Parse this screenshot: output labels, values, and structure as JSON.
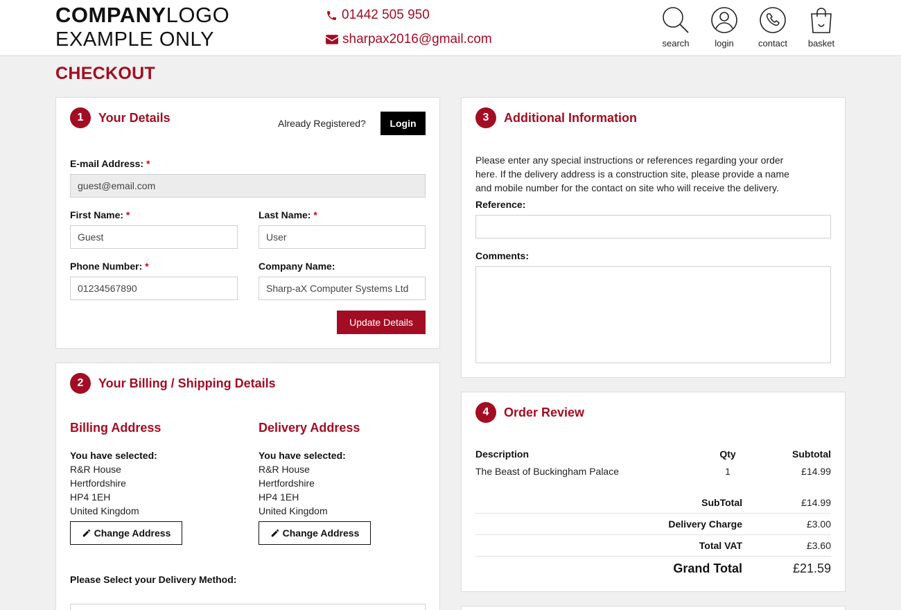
{
  "header": {
    "logo_line1_bold": "COMPANY",
    "logo_line1_light": "LOGO",
    "logo_line2": "EXAMPLE ONLY",
    "phone": "01442 505 950",
    "email": "sharpax2016@gmail.com",
    "nav": [
      {
        "label": "search",
        "icon": "search-icon"
      },
      {
        "label": "login",
        "icon": "user-icon"
      },
      {
        "label": "contact",
        "icon": "phone-icon"
      },
      {
        "label": "basket",
        "icon": "basket-icon"
      }
    ]
  },
  "page_title": "CHECKOUT",
  "colors": {
    "accent": "#a20d23",
    "black_button": "#000000",
    "background": "#f0f0f0"
  },
  "details": {
    "number": "1",
    "title": "Your Details",
    "already_registered": "Already Registered?",
    "login_label": "Login",
    "email_label": "E-mail Address:",
    "email_value": "guest@email.com",
    "first_name_label": "First Name:",
    "first_name_value": "Guest",
    "last_name_label": "Last Name:",
    "last_name_value": "User",
    "phone_label": "Phone Number:",
    "phone_value": "01234567890",
    "company_label": "Company Name:",
    "company_value": "Sharp-aX Computer Systems Ltd",
    "required_mark": "*",
    "update_label": "Update Details"
  },
  "billing": {
    "number": "2",
    "title": "Your Billing / Shipping Details",
    "billing_title": "Billing Address",
    "delivery_title": "Delivery Address",
    "selected_label": "You have selected:",
    "billing_lines": [
      "R&R House",
      "Hertfordshire",
      "HP4 1EH",
      "United Kingdom"
    ],
    "delivery_lines": [
      "R&R House",
      "Hertfordshire",
      "HP4 1EH",
      "United Kingdom"
    ],
    "change_label": "Change Address",
    "delivery_method_label": "Please Select your Delivery Method:"
  },
  "additional": {
    "number": "3",
    "title": "Additional Information",
    "instructions_line1": "Please enter any special instructions or references regarding your order",
    "instructions_line2": "here. If the delivery address is a construction site, please provide a name",
    "instructions_line3": "and mobile number for the contact on site who will receive the delivery.",
    "reference_label": "Reference:",
    "comments_label": "Comments:"
  },
  "order": {
    "number": "4",
    "title": "Order Review",
    "col_description": "Description",
    "col_qty": "Qty",
    "col_subtotal": "Subtotal",
    "items": [
      {
        "description": "The Beast of Buckingham Palace",
        "qty": "1",
        "subtotal": "£14.99"
      }
    ],
    "subtotal_label": "SubTotal",
    "subtotal_value": "£14.99",
    "delivery_label": "Delivery Charge",
    "delivery_value": "£3.00",
    "vat_label": "Total VAT",
    "vat_value": "£3.60",
    "grand_label": "Grand Total",
    "grand_value": "£21.59"
  }
}
